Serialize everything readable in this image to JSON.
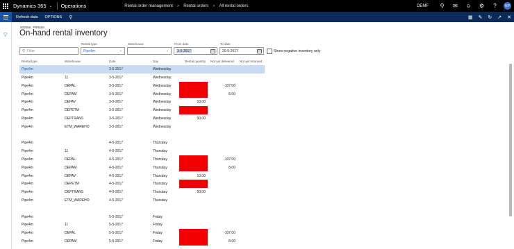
{
  "topbar": {
    "app_name": "Dynamics 365",
    "module": "Operations",
    "breadcrumbs": [
      "Rental order management",
      "Rental orders",
      "All rental orders"
    ],
    "company": "DEMF",
    "avatar_initials": "NP"
  },
  "actionbar": {
    "refresh_label": "Refresh data",
    "options_label": "OPTIONS"
  },
  "header": {
    "record_id": "000558 : PIP64M",
    "title": "On-hand rental inventory"
  },
  "filters": {
    "filter_placeholder": "Filter",
    "rental_type_label": "Rental type",
    "rental_type_value": "Pipe4m",
    "warehouse_label": "Warehouse",
    "warehouse_value": "",
    "from_date_label": "From date",
    "from_date_value": "3-5-2017",
    "to_date_label": "To date",
    "to_date_value": "20-5-2017",
    "show_negative_label": "Show negative inventory only"
  },
  "grid": {
    "columns": [
      "Rental type",
      "Warehouse",
      "Date",
      "Day",
      "Rental quantity",
      "Not yet delivered",
      "Not yet returned"
    ],
    "rows": [
      {
        "type": "Pipe4m",
        "wh": "",
        "date": "3-5-2017",
        "day": "Wednesday",
        "qty": "",
        "nyd": "",
        "nyr": ""
      },
      {
        "type": "Pipe4m",
        "wh": "11",
        "date": "3-5-2017",
        "day": "Wednesday",
        "qty": "",
        "nyd": "",
        "nyr": ""
      },
      {
        "type": "Pipe4m",
        "wh": "DEPAL",
        "date": "3-5-2017",
        "day": "Wednesday",
        "qty": "",
        "nyd": "-107.00",
        "nyr": ""
      },
      {
        "type": "Pipe4m",
        "wh": "DEPAM",
        "date": "3-5-2017",
        "day": "Wednesday",
        "qty": "",
        "nyd": "-5.00",
        "nyr": ""
      },
      {
        "type": "Pipe4m",
        "wh": "DEPAV",
        "date": "3-5-2017",
        "day": "Wednesday",
        "qty": "10.00",
        "nyd": "",
        "nyr": ""
      },
      {
        "type": "Pipe4m",
        "wh": "DEPETM",
        "date": "3-5-2017",
        "day": "Wednesday",
        "qty": "",
        "nyd": "",
        "nyr": ""
      },
      {
        "type": "Pipe4m",
        "wh": "DEPTRANS",
        "date": "3-5-2017",
        "day": "Wednesday",
        "qty": "50.00",
        "nyd": "",
        "nyr": ""
      },
      {
        "type": "Pipe4m",
        "wh": "ETM_WAREHO",
        "date": "3-5-2017",
        "day": "Wednesday",
        "qty": "",
        "nyd": "",
        "nyr": ""
      },
      {
        "type": "",
        "wh": "",
        "date": "",
        "day": "",
        "qty": "",
        "nyd": "",
        "nyr": ""
      },
      {
        "type": "Pipe4m",
        "wh": "",
        "date": "4-5-2017",
        "day": "Thursday",
        "qty": "",
        "nyd": "",
        "nyr": ""
      },
      {
        "type": "Pipe4m",
        "wh": "11",
        "date": "4-5-2017",
        "day": "Thursday",
        "qty": "",
        "nyd": "",
        "nyr": ""
      },
      {
        "type": "Pipe4m",
        "wh": "DEPAL",
        "date": "4-5-2017",
        "day": "Thursday",
        "qty": "",
        "nyd": "-107.00",
        "nyr": ""
      },
      {
        "type": "Pipe4m",
        "wh": "DEPAM",
        "date": "4-5-2017",
        "day": "Thursday",
        "qty": "",
        "nyd": "-5.00",
        "nyr": ""
      },
      {
        "type": "Pipe4m",
        "wh": "DEPAV",
        "date": "4-5-2017",
        "day": "Thursday",
        "qty": "10.00",
        "nyd": "",
        "nyr": ""
      },
      {
        "type": "Pipe4m",
        "wh": "DEPETM",
        "date": "4-5-2017",
        "day": "Thursday",
        "qty": "",
        "nyd": "",
        "nyr": ""
      },
      {
        "type": "Pipe4m",
        "wh": "DEPTRANS",
        "date": "4-5-2017",
        "day": "Thursday",
        "qty": "50.00",
        "nyd": "",
        "nyr": ""
      },
      {
        "type": "Pipe4m",
        "wh": "ETM_WAREHO",
        "date": "4-5-2017",
        "day": "Thursday",
        "qty": "",
        "nyd": "",
        "nyr": ""
      },
      {
        "type": "",
        "wh": "",
        "date": "",
        "day": "",
        "qty": "",
        "nyd": "",
        "nyr": ""
      },
      {
        "type": "Pipe4m",
        "wh": "",
        "date": "5-5-2017",
        "day": "Friday",
        "qty": "",
        "nyd": "",
        "nyr": ""
      },
      {
        "type": "Pipe4m",
        "wh": "11",
        "date": "5-5-2017",
        "day": "Friday",
        "qty": "",
        "nyd": "",
        "nyr": ""
      },
      {
        "type": "Pipe4m",
        "wh": "DEPAL",
        "date": "5-5-2017",
        "day": "Friday",
        "qty": "",
        "nyd": "-107.00",
        "nyr": ""
      },
      {
        "type": "Pipe4m",
        "wh": "DEPAM",
        "date": "5-5-2017",
        "day": "Friday",
        "qty": "",
        "nyd": "-5.00",
        "nyr": ""
      }
    ]
  },
  "colors": {
    "top_bar": "#000000",
    "action_bar": "#0a2b5a",
    "accent": "#1a54a6",
    "negative_highlight": "#f20000",
    "selected_row": "#c7dcf2"
  }
}
